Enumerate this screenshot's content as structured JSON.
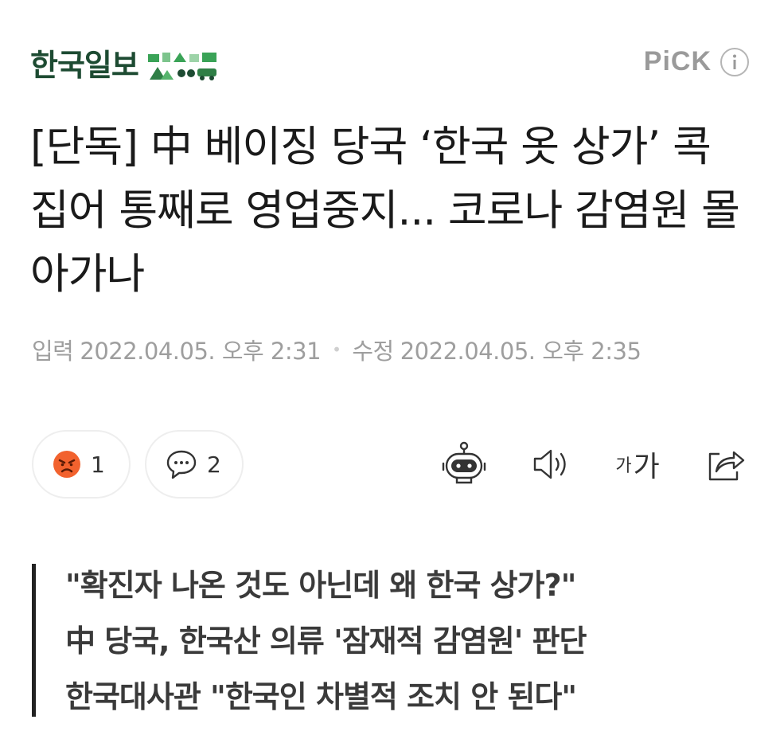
{
  "header": {
    "brand_name": "한국일보",
    "pick_label": "PiCK"
  },
  "article": {
    "headline": "[단독] 中 베이징 당국 ‘한국 옷 상가’ 콕 집어 통째로 영업중지... 코로나 감염원 몰아가나",
    "meta": {
      "input_label": "입력",
      "input_time": "2022.04.05. 오후 2:31",
      "separator": "•",
      "modified_label": "수정",
      "modified_time": "2022.04.05. 오후 2:35"
    }
  },
  "actions": {
    "reaction_count": "1",
    "comment_count": "2",
    "font_small": "가",
    "font_big": "가"
  },
  "summary": {
    "lines": [
      "\"확진자 나온 것도 아닌데 왜 한국 상가?\"",
      "中 당국, 한국산 의류 '잠재적 감염원' 판단",
      "한국대사관 \"한국인 차별적 조치 안 된다\""
    ]
  },
  "icons": {
    "logo": "hankook-ilbo-logo-icon",
    "info": "info-icon",
    "angry_reaction": "angry-face-icon",
    "comment": "comment-bubble-icon",
    "bot": "robot-icon",
    "sound": "speaker-icon",
    "share": "share-icon"
  },
  "colors": {
    "brand": "#1d4b32",
    "brand_logo_green": "#3aa357",
    "angry": "#f2622e",
    "meta_text": "#9e9e9e"
  }
}
